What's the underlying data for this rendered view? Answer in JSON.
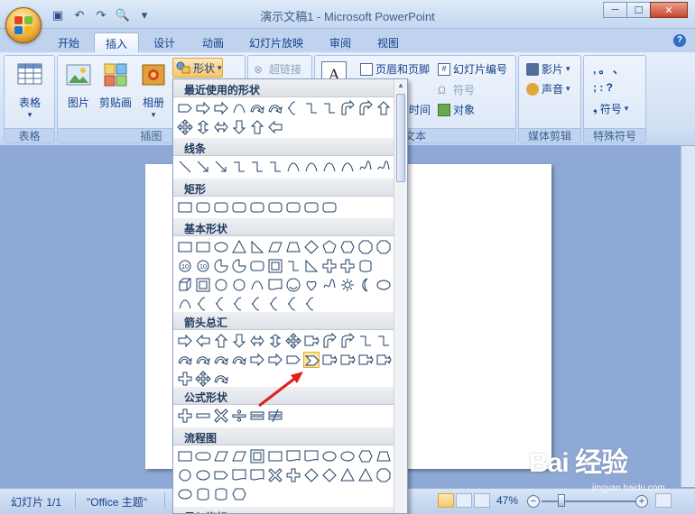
{
  "window": {
    "title": "演示文稿1 - Microsoft PowerPoint",
    "minimize": "─",
    "maximize": "☐",
    "close": "✕"
  },
  "tabs": [
    "开始",
    "插入",
    "设计",
    "动画",
    "幻灯片放映",
    "审阅",
    "视图"
  ],
  "active_tab": "插入",
  "ribbon": {
    "table_group": {
      "button": "表格",
      "label": "表格"
    },
    "illustrations": {
      "picture": "图片",
      "clipart": "剪贴画",
      "album": "相册",
      "shapes": "形状",
      "label": "插图"
    },
    "links": {
      "hyperlink": "超链接"
    },
    "text": {
      "textbox_letter": "A",
      "header_footer": "页眉和页脚",
      "slide_number": "幻灯片编号",
      "symbol": "符号",
      "datetime": "时间",
      "object": "对象",
      "label": "文本"
    },
    "media": {
      "movie": "影片",
      "sound": "声音",
      "label": "媒体剪辑"
    },
    "special": {
      "row1": ",  。  、",
      "row2": ";  :  ?",
      "symbol": "符号",
      "label": "特殊符号"
    }
  },
  "shapes_menu": {
    "sections": [
      {
        "title": "最近使用的形状"
      },
      {
        "title": "线条"
      },
      {
        "title": "矩形"
      },
      {
        "title": "基本形状"
      },
      {
        "title": "箭头总汇"
      },
      {
        "title": "公式形状"
      },
      {
        "title": "流程图"
      },
      {
        "title": "星与旗帜"
      }
    ]
  },
  "status": {
    "slide_info": "幻灯片 1/1",
    "theme": "\"Office 主题\"",
    "zoom": "47%",
    "zoom_out": "−",
    "zoom_in": "+"
  },
  "watermark": {
    "logo": "Bai 经验",
    "url": "jingyan.baidu.com"
  }
}
